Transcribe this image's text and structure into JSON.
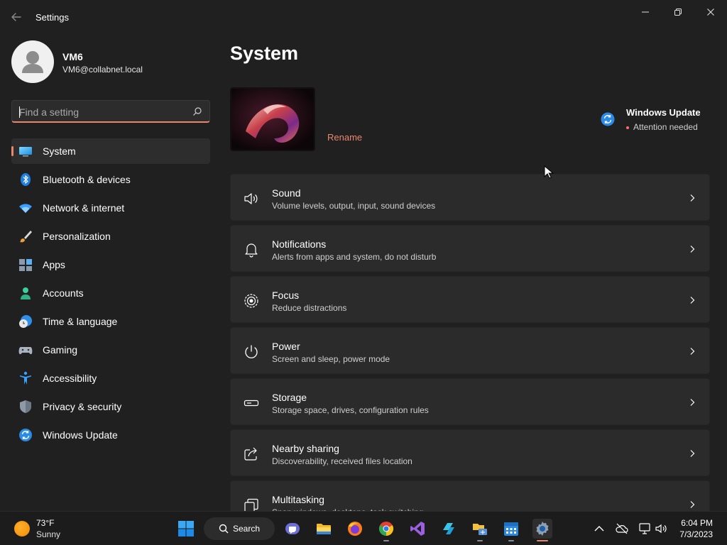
{
  "window": {
    "title": "Settings"
  },
  "profile": {
    "name": "VM6",
    "email": "VM6@collabnet.local"
  },
  "search": {
    "placeholder": "Find a setting",
    "value": ""
  },
  "sidebar": {
    "items": [
      {
        "label": "System",
        "icon": "system-icon",
        "active": true
      },
      {
        "label": "Bluetooth & devices",
        "icon": "bluetooth-icon"
      },
      {
        "label": "Network & internet",
        "icon": "wifi-icon"
      },
      {
        "label": "Personalization",
        "icon": "brush-icon"
      },
      {
        "label": "Apps",
        "icon": "apps-icon"
      },
      {
        "label": "Accounts",
        "icon": "person-icon"
      },
      {
        "label": "Time & language",
        "icon": "clock-globe-icon"
      },
      {
        "label": "Gaming",
        "icon": "controller-icon"
      },
      {
        "label": "Accessibility",
        "icon": "accessibility-icon"
      },
      {
        "label": "Privacy & security",
        "icon": "shield-icon"
      },
      {
        "label": "Windows Update",
        "icon": "update-icon"
      }
    ]
  },
  "main": {
    "title": "System",
    "rename_label": "Rename",
    "windows_update": {
      "title": "Windows Update",
      "status": "Attention needed"
    },
    "cards": [
      {
        "title": "Sound",
        "description": "Volume levels, output, input, sound devices",
        "icon": "speaker-icon"
      },
      {
        "title": "Notifications",
        "description": "Alerts from apps and system, do not disturb",
        "icon": "bell-icon"
      },
      {
        "title": "Focus",
        "description": "Reduce distractions",
        "icon": "focus-icon"
      },
      {
        "title": "Power",
        "description": "Screen and sleep, power mode",
        "icon": "power-icon"
      },
      {
        "title": "Storage",
        "description": "Storage space, drives, configuration rules",
        "icon": "storage-icon"
      },
      {
        "title": "Nearby sharing",
        "description": "Discoverability, received files location",
        "icon": "share-icon"
      },
      {
        "title": "Multitasking",
        "description": "Snap windows, desktops, task switching",
        "icon": "multitasking-icon"
      }
    ]
  },
  "taskbar": {
    "weather": {
      "temp": "73°F",
      "condition": "Sunny"
    },
    "search_label": "Search",
    "apps": [
      "start-icon",
      "teams-icon",
      "file-explorer-icon",
      "firefox-icon",
      "chrome-icon",
      "visual-studio-icon",
      "azure-icon",
      "explorer-shortcut-icon",
      "calendar-icon",
      "settings-icon"
    ],
    "clock": {
      "time": "6:04 PM",
      "date": "7/3/2023"
    }
  },
  "colors": {
    "accent": "#e9866c",
    "background": "#202020",
    "card": "#2b2b2b"
  }
}
